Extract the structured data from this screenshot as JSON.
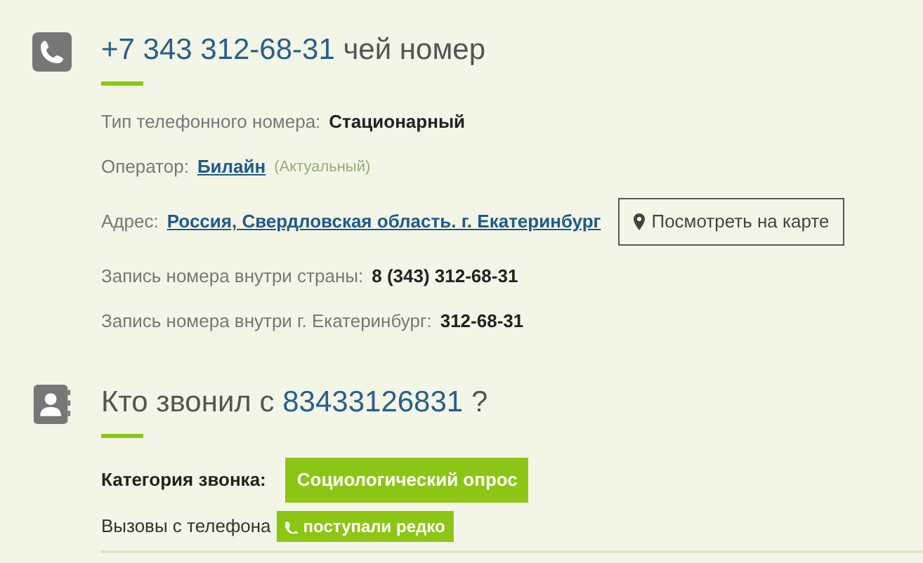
{
  "phone_section": {
    "title_number": "+7 343 312-68-31",
    "title_text": "чей номер",
    "fields": [
      {
        "kind": "plain",
        "label": "Тип телефонного номера:",
        "value": "Стационарный"
      },
      {
        "kind": "link",
        "label": "Оператор:",
        "value": "Билайн",
        "note": "(Актуальный)"
      },
      {
        "kind": "map",
        "label": "Адрес:",
        "value": "Россия, Свердловская область. г. Екатеринбург",
        "button": "Посмотреть на карте"
      },
      {
        "kind": "plain",
        "label": "Запись номера внутри страны:",
        "value": "8 (343) 312-68-31"
      },
      {
        "kind": "plain",
        "label": "Запись номера внутри г. Екатеринбург:",
        "value": "312-68-31"
      }
    ]
  },
  "caller_section": {
    "title_text": "Кто звонил с",
    "title_number": "83433126831",
    "title_suffix": "?",
    "category_label": "Категория звонка:",
    "category": "Социологический опрос",
    "calls_label": "Вызовы с телефона",
    "calls_badge": "поступали редко"
  }
}
